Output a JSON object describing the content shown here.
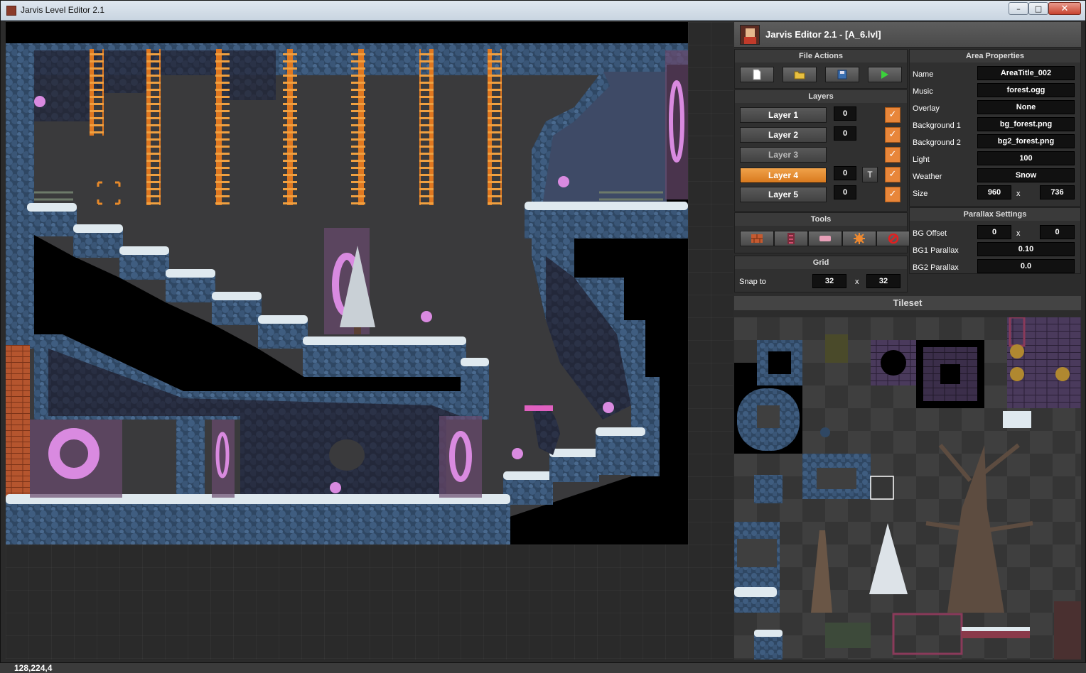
{
  "window": {
    "title": "Jarvis Level Editor 2.1"
  },
  "status": {
    "coords": "128,224,4"
  },
  "panel": {
    "title": "Jarvis Editor 2.1 - [A_6.lvl]",
    "file_actions": {
      "title": "File Actions",
      "buttons": [
        {
          "name": "new-file",
          "icon": "new-file-icon"
        },
        {
          "name": "open-file",
          "icon": "open-folder-icon"
        },
        {
          "name": "save-file",
          "icon": "save-disk-icon"
        },
        {
          "name": "play",
          "icon": "play-icon"
        }
      ]
    },
    "layers": {
      "title": "Layers",
      "items": [
        {
          "label": "Layer 1",
          "value": "0",
          "visible": true,
          "active": false
        },
        {
          "label": "Layer 2",
          "value": "0",
          "visible": true,
          "active": false
        },
        {
          "label": "Layer 3",
          "value": "",
          "visible": true,
          "active": false
        },
        {
          "label": "Layer 4",
          "value": "0",
          "visible": true,
          "active": true,
          "toggle": "T"
        },
        {
          "label": "Layer 5",
          "value": "0",
          "visible": true,
          "active": false
        }
      ]
    },
    "tools": {
      "title": "Tools",
      "items": [
        "brick-tool-icon",
        "ladder-tool-icon",
        "platform-tool-icon",
        "spike-tool-icon",
        "erase-tool-icon"
      ]
    },
    "grid": {
      "title": "Grid",
      "snap_label": "Snap to",
      "snap_x": "32",
      "sep": "x",
      "snap_y": "32"
    },
    "area_properties": {
      "title": "Area Properties",
      "name_label": "Name",
      "name": "AreaTitle_002",
      "music_label": "Music",
      "music": "forest.ogg",
      "overlay_label": "Overlay",
      "overlay": "None",
      "bg1_label": "Background 1",
      "bg1": "bg_forest.png",
      "bg2_label": "Background 2",
      "bg2": "bg2_forest.png",
      "light_label": "Light",
      "light": "100",
      "weather_label": "Weather",
      "weather": "Snow",
      "size_label": "Size",
      "size_w": "960",
      "size_sep": "x",
      "size_h": "736"
    },
    "parallax": {
      "title": "Parallax Settings",
      "offset_label": "BG Offset",
      "offset_x": "0",
      "offset_sep": "x",
      "offset_y": "0",
      "bg1_label": "BG1 Parallax",
      "bg1": "0.10",
      "bg2_label": "BG2 Parallax",
      "bg2": "0.0"
    },
    "tileset": {
      "title": "Tileset"
    }
  },
  "colors": {
    "accent_orange": "#e8863a",
    "rock_blue": "#3e5878",
    "snow": "#dfe9ef",
    "portal_pink": "#d98ae0",
    "ladder_orange": "#e07820"
  }
}
